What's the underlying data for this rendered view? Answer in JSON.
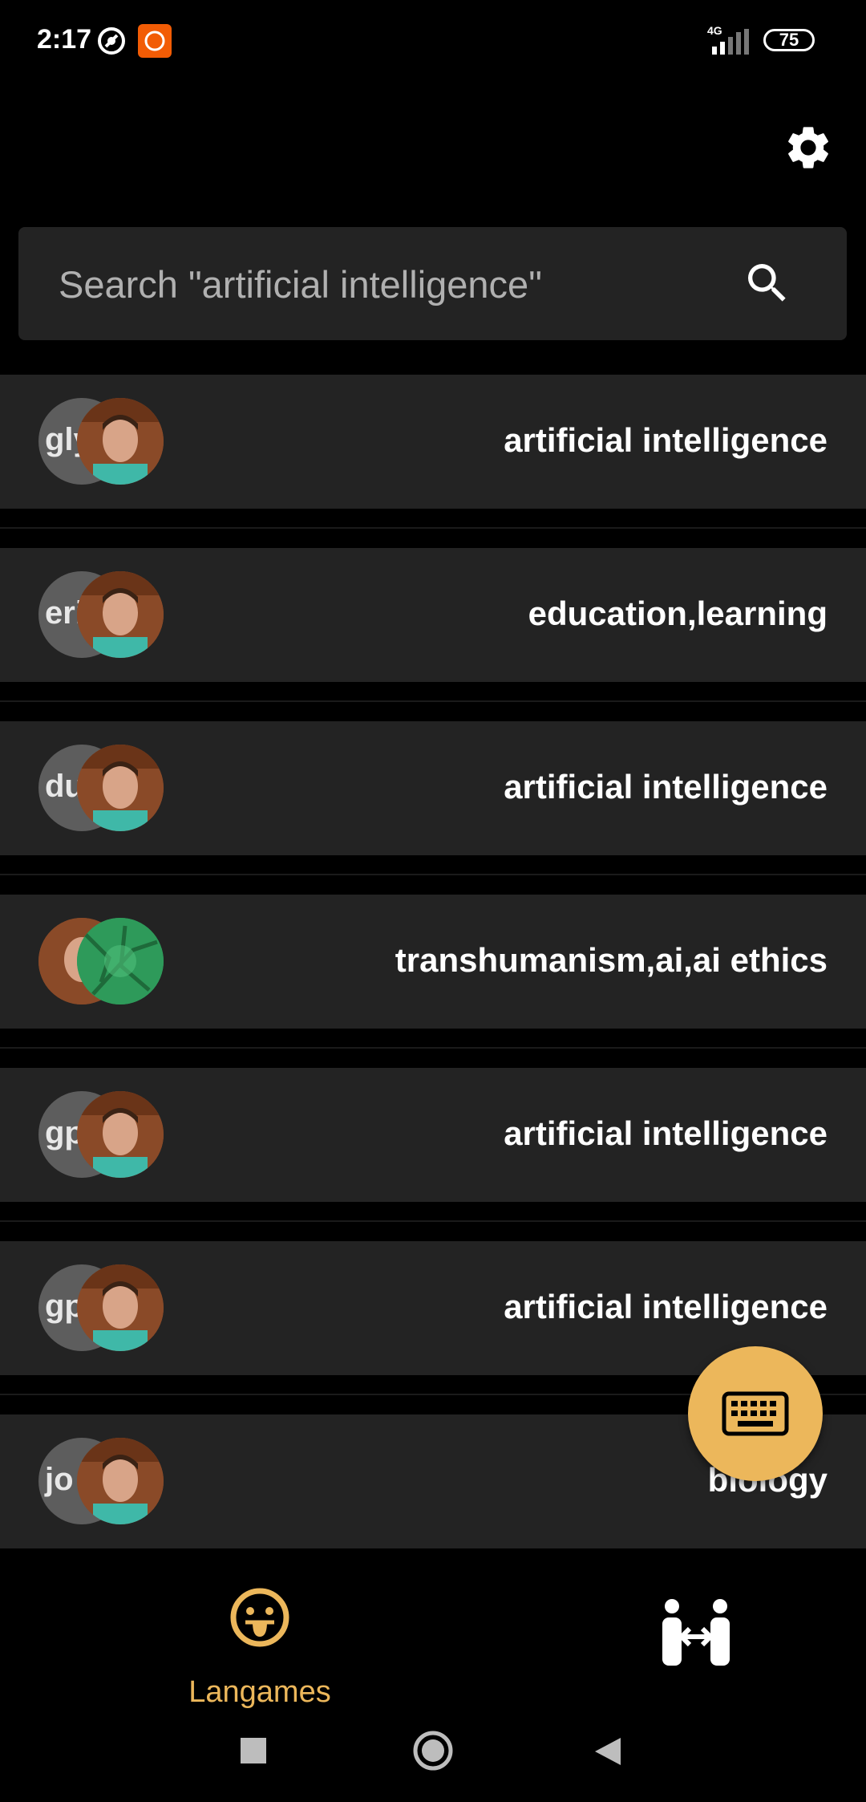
{
  "status_bar": {
    "time": "2:17",
    "network_label": "4G",
    "battery": "75",
    "icons": [
      "sync-circle-icon",
      "mi-app-icon",
      "signal-icon",
      "battery-icon"
    ]
  },
  "header": {
    "settings_icon": "gear-icon"
  },
  "search": {
    "placeholder": "Search \"artificial intelligence\"",
    "icon": "search-icon"
  },
  "games": [
    {
      "initials": "gly",
      "tags": "artificial intelligence",
      "photo": "person-photo"
    },
    {
      "initials": "eri",
      "tags": "education,learning",
      "photo": "person-photo"
    },
    {
      "initials": "du",
      "tags": "artificial intelligence",
      "photo": "person-photo"
    },
    {
      "initials": "",
      "tags": "transhumanism,ai,ai ethics",
      "photo": "green-photo"
    },
    {
      "initials": "gp",
      "tags": "artificial intelligence",
      "photo": "person-photo"
    },
    {
      "initials": "gp",
      "tags": "artificial intelligence",
      "photo": "person-photo"
    },
    {
      "initials": "jo",
      "tags": "biology",
      "photo": "person-photo"
    }
  ],
  "fab": {
    "icon": "keyboard-icon"
  },
  "bottom_nav": {
    "tabs": [
      {
        "label": "Langames",
        "icon": "tongue-face-icon",
        "active": true
      },
      {
        "label": "",
        "icon": "people-connect-icon",
        "active": false
      }
    ]
  },
  "colors": {
    "accent": "#ecb75b",
    "card": "#232323",
    "background": "#000000"
  }
}
